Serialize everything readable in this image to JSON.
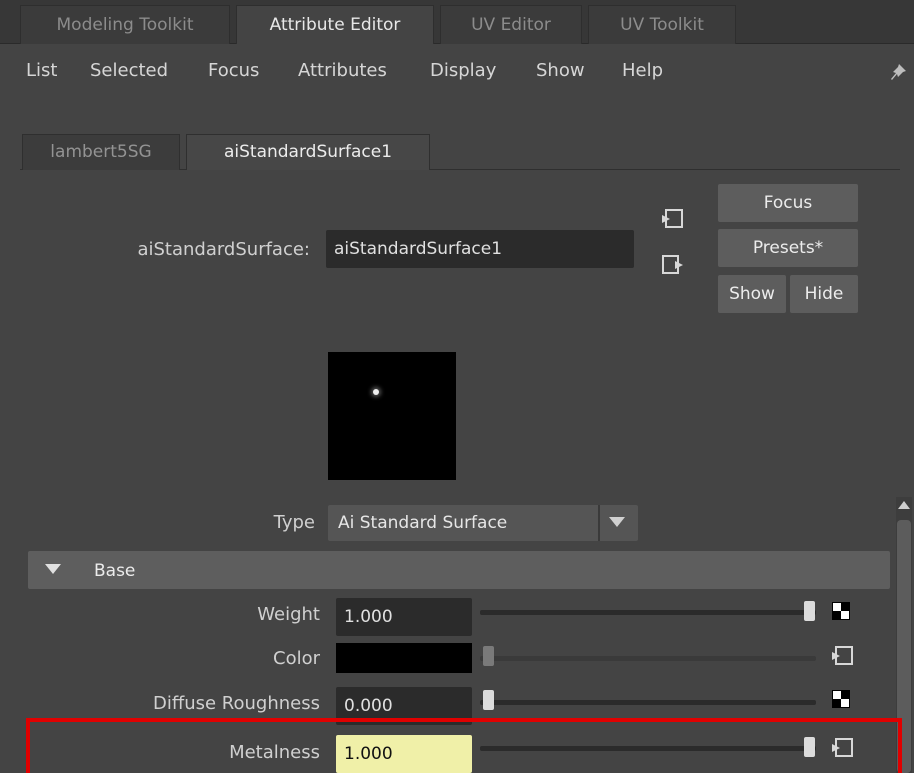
{
  "top_tabs": [
    "Modeling Toolkit",
    "Attribute Editor",
    "UV Editor",
    "UV Toolkit"
  ],
  "menu": [
    "List",
    "Selected",
    "Focus",
    "Attributes",
    "Display",
    "Show",
    "Help"
  ],
  "node_tabs": [
    "lambert5SG",
    "aiStandardSurface1"
  ],
  "header": {
    "node_type_label": "aiStandardSurface:",
    "node_name": "aiStandardSurface1",
    "buttons": {
      "focus": "Focus",
      "presets": "Presets*",
      "show": "Show",
      "hide": "Hide"
    }
  },
  "type_row": {
    "label": "Type",
    "value": "Ai Standard Surface"
  },
  "section": {
    "title": "Base",
    "expanded": true
  },
  "attributes": {
    "weight": {
      "label": "Weight",
      "value": "1.000",
      "slider": 1.0
    },
    "color": {
      "label": "Color",
      "color": "#000000"
    },
    "diffuse_roughness": {
      "label": "Diffuse Roughness",
      "value": "0.000",
      "slider": 0.0
    },
    "metalness": {
      "label": "Metalness",
      "value": "1.000",
      "slider": 1.0,
      "highlight_field": "#f0f0a8",
      "highlight_border": "#e00000"
    }
  }
}
